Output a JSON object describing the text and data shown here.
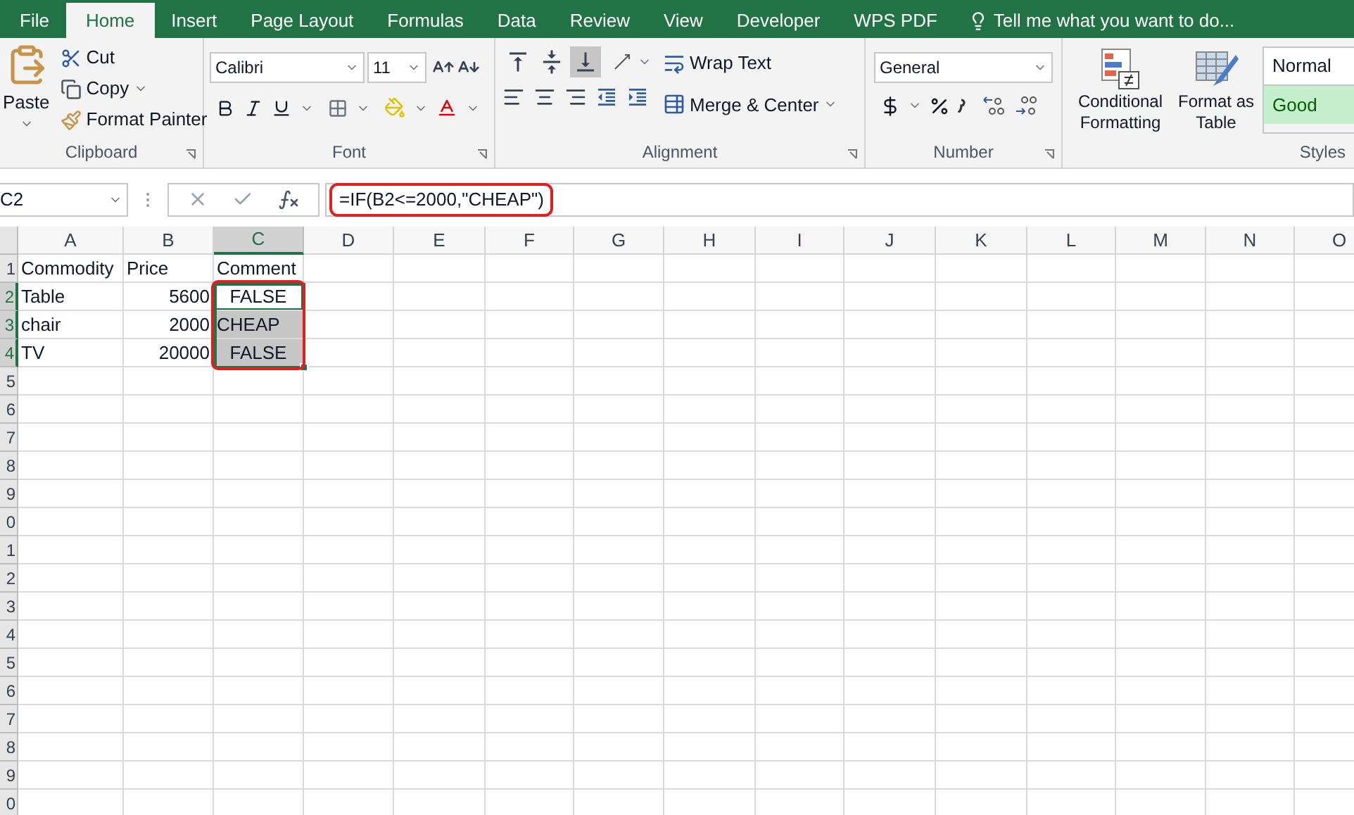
{
  "tabs": [
    {
      "label": "File",
      "selected": false
    },
    {
      "label": "Home",
      "selected": true
    },
    {
      "label": "Insert",
      "selected": false
    },
    {
      "label": "Page Layout",
      "selected": false
    },
    {
      "label": "Formulas",
      "selected": false
    },
    {
      "label": "Data",
      "selected": false
    },
    {
      "label": "Review",
      "selected": false
    },
    {
      "label": "View",
      "selected": false
    },
    {
      "label": "Developer",
      "selected": false
    },
    {
      "label": "WPS PDF",
      "selected": false
    }
  ],
  "tell_me": "Tell me what you want to do...",
  "clipboard": {
    "paste": "Paste",
    "cut": "Cut",
    "copy": "Copy",
    "format_painter": "Format Painter",
    "label": "Clipboard"
  },
  "font": {
    "font_name": "Calibri",
    "font_size": "11",
    "label": "Font"
  },
  "alignment": {
    "vertical_align": [
      {
        "selected": false
      },
      {
        "selected": false
      },
      {
        "selected": true
      }
    ],
    "wrap_text": "Wrap Text",
    "merge_center": "Merge & Center",
    "label": "Alignment"
  },
  "number": {
    "format": "General",
    "label": "Number"
  },
  "styles": {
    "conditional_formatting": "Conditional Formatting",
    "format_as_table": "Format as Table",
    "cell_styles": [
      {
        "label": "Normal",
        "kind": "normal"
      },
      {
        "label": "Good",
        "kind": "good"
      }
    ],
    "label": "Styles"
  },
  "formula_bar": {
    "name_box": "C2",
    "formula": "=IF(B2<=2000,\"CHEAP\")"
  },
  "sheet": {
    "columns": [
      {
        "label": "A",
        "selected": false
      },
      {
        "label": "B",
        "selected": false
      },
      {
        "label": "C",
        "selected": true
      },
      {
        "label": "D",
        "selected": false
      },
      {
        "label": "E",
        "selected": false
      },
      {
        "label": "F",
        "selected": false
      },
      {
        "label": "G",
        "selected": false
      },
      {
        "label": "H",
        "selected": false
      },
      {
        "label": "I",
        "selected": false
      },
      {
        "label": "J",
        "selected": false
      },
      {
        "label": "K",
        "selected": false
      },
      {
        "label": "L",
        "selected": false
      },
      {
        "label": "M",
        "selected": false
      },
      {
        "label": "N",
        "selected": false
      },
      {
        "label": "O",
        "selected": false
      }
    ],
    "rows": [
      {
        "label": "1",
        "selected": false,
        "cells": [
          {
            "value": "Commodity",
            "kind": "text",
            "selected": false
          },
          {
            "value": "Price",
            "kind": "text",
            "selected": false
          },
          {
            "value": "Comment",
            "kind": "text",
            "selected": false
          }
        ]
      },
      {
        "label": "2",
        "selected": true,
        "cells": [
          {
            "value": "Table",
            "kind": "text",
            "selected": false
          },
          {
            "value": "5600",
            "kind": "number",
            "selected": false
          },
          {
            "value": "FALSE",
            "kind": "boolean",
            "selected": true,
            "active": true
          }
        ]
      },
      {
        "label": "3",
        "selected": true,
        "cells": [
          {
            "value": "chair",
            "kind": "text",
            "selected": false
          },
          {
            "value": "2000",
            "kind": "number",
            "selected": false
          },
          {
            "value": "CHEAP",
            "kind": "text",
            "selected": true,
            "active": false
          }
        ]
      },
      {
        "label": "4",
        "selected": true,
        "cells": [
          {
            "value": "TV",
            "kind": "text",
            "selected": false
          },
          {
            "value": "20000",
            "kind": "number",
            "selected": false
          },
          {
            "value": "FALSE",
            "kind": "boolean",
            "selected": true,
            "active": false
          }
        ]
      },
      {
        "label": "5",
        "selected": false
      },
      {
        "label": "6",
        "selected": false
      },
      {
        "label": "7",
        "selected": false
      },
      {
        "label": "8",
        "selected": false
      },
      {
        "label": "9",
        "selected": false
      },
      {
        "label": "0",
        "selected": false
      },
      {
        "label": "1",
        "selected": false
      },
      {
        "label": "2",
        "selected": false
      },
      {
        "label": "3",
        "selected": false
      },
      {
        "label": "4",
        "selected": false
      },
      {
        "label": "5",
        "selected": false
      },
      {
        "label": "6",
        "selected": false
      },
      {
        "label": "7",
        "selected": false
      },
      {
        "label": "8",
        "selected": false
      },
      {
        "label": "9",
        "selected": false
      },
      {
        "label": "0",
        "selected": false
      }
    ]
  }
}
